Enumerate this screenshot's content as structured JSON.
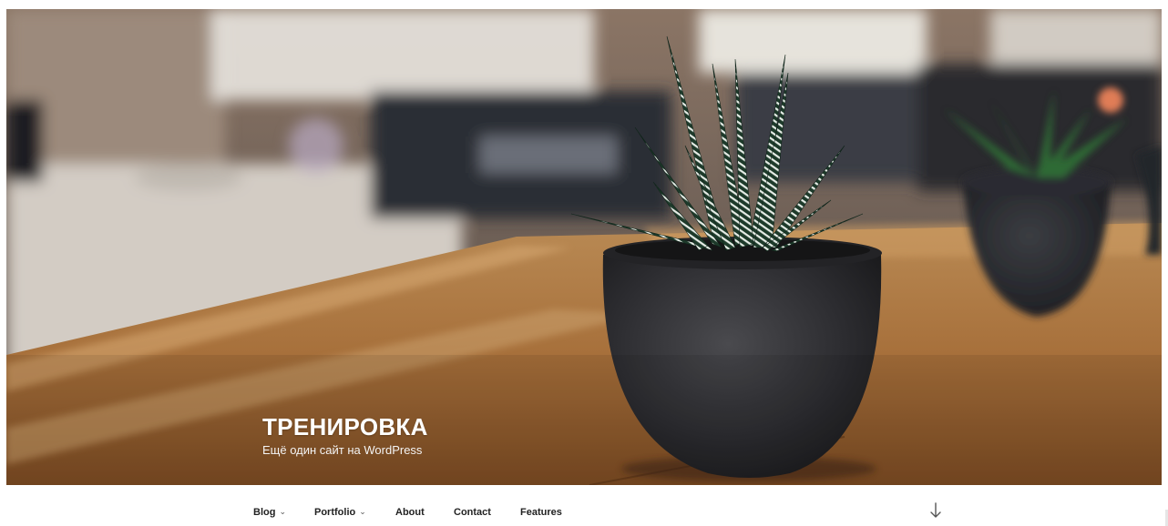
{
  "site": {
    "title": "ТРЕНИРОВКА",
    "description": "Ещё один сайт на WordPress"
  },
  "nav": {
    "items": [
      {
        "label": "Blog",
        "has_submenu": true
      },
      {
        "label": "Portfolio",
        "has_submenu": true
      },
      {
        "label": "About",
        "has_submenu": false
      },
      {
        "label": "Contact",
        "has_submenu": false
      },
      {
        "label": "Features",
        "has_submenu": false
      }
    ],
    "submenu_indicator": "⌄",
    "scroll_icon": "arrow-down-icon"
  },
  "colors": {
    "text_dark": "#222222",
    "header_text": "#ffffff",
    "background": "#ffffff"
  }
}
